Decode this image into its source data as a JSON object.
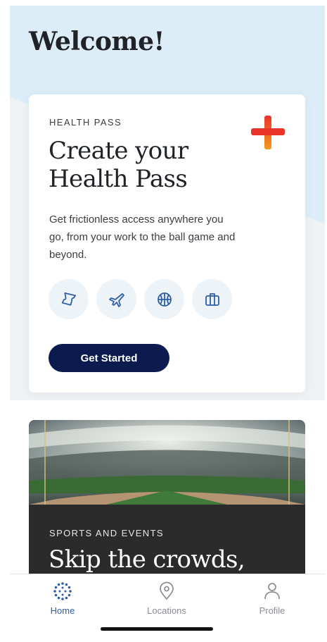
{
  "header": {
    "title": "Welcome!"
  },
  "health_card": {
    "eyebrow": "HEALTH PASS",
    "title_line1": "Create your",
    "title_line2": "Health Pass",
    "body": "Get frictionless access anywhere you go, from your work to the ball game and beyond.",
    "icons": [
      "ticket-icon",
      "airplane-icon",
      "basketball-icon",
      "briefcase-icon"
    ],
    "cta_label": "Get Started",
    "plus_icon": "medical-plus-icon"
  },
  "sports_card": {
    "eyebrow": "SPORTS AND EVENTS",
    "title": "Skip the crowds,"
  },
  "tabbar": {
    "items": [
      {
        "label": "Home",
        "icon": "home-dots-icon",
        "active": true
      },
      {
        "label": "Locations",
        "icon": "location-pin-icon",
        "active": false
      },
      {
        "label": "Profile",
        "icon": "person-icon",
        "active": false
      }
    ]
  },
  "colors": {
    "accent": "#0b1b4f",
    "icon_blue": "#2f5fa7",
    "plus_red": "#e8342a",
    "plus_orange": "#f39a1d"
  }
}
